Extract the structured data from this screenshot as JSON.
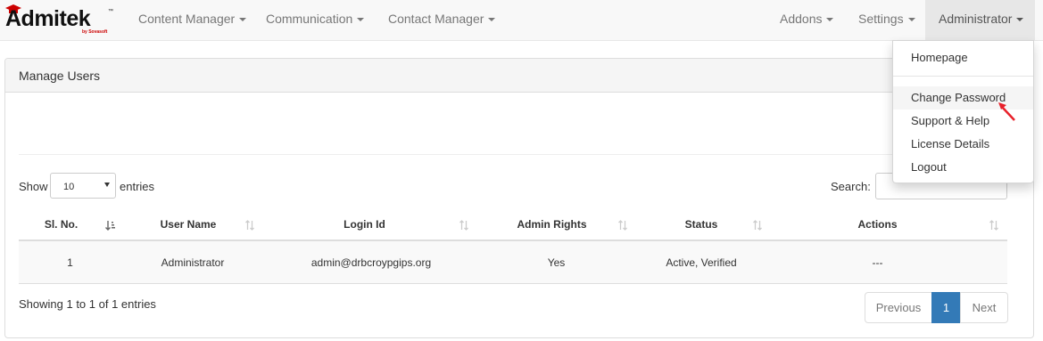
{
  "brand": {
    "name": "Admitek",
    "tagline": "by Sovasoft",
    "tm": "™"
  },
  "nav": {
    "left": [
      {
        "label": "Content Manager"
      },
      {
        "label": "Communication"
      },
      {
        "label": "Contact Manager"
      }
    ],
    "right": [
      {
        "label": "Addons"
      },
      {
        "label": "Settings"
      },
      {
        "label": "Administrator"
      }
    ]
  },
  "panel": {
    "title": "Manage Users"
  },
  "length_menu": {
    "show": "Show",
    "value": "10",
    "entries": "entries"
  },
  "search": {
    "label": "Search:",
    "value": ""
  },
  "table": {
    "columns": [
      "Sl. No.",
      "User Name",
      "Login Id",
      "Admin Rights",
      "Status",
      "Actions"
    ],
    "rows": [
      {
        "sl": "1",
        "user": "Administrator",
        "login": "admin@drbcroypgips.org",
        "admin": "Yes",
        "status": "Active, Verified",
        "actions": "---"
      }
    ]
  },
  "info": "Showing 1 to 1 of 1 entries",
  "pagination": {
    "previous": "Previous",
    "current": "1",
    "next": "Next"
  },
  "dropdown": {
    "items": [
      {
        "label": "Homepage"
      },
      {
        "label": "Change Password"
      },
      {
        "label": "Support & Help"
      },
      {
        "label": "License Details"
      },
      {
        "label": "Logout"
      }
    ]
  },
  "colors": {
    "primary": "#337ab7",
    "navbar": "#f8f8f8",
    "cursor": "#e8202a",
    "brand_red": "#cc0000"
  }
}
